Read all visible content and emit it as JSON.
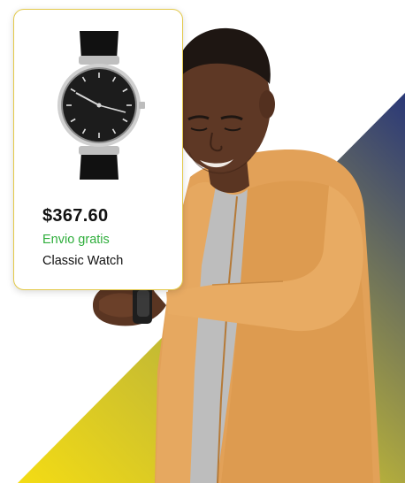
{
  "product_card": {
    "price": "$367.60",
    "shipping": "Envio gratis",
    "name": "Classic Watch"
  },
  "colors": {
    "gradient_yellow": "#f0d619",
    "gradient_navy": "#2d3a78",
    "shipping_green": "#2fae3c",
    "card_border": "#e3c94a",
    "jacket": "#e4a35b"
  },
  "icons": {
    "product_image": "watch-icon"
  }
}
